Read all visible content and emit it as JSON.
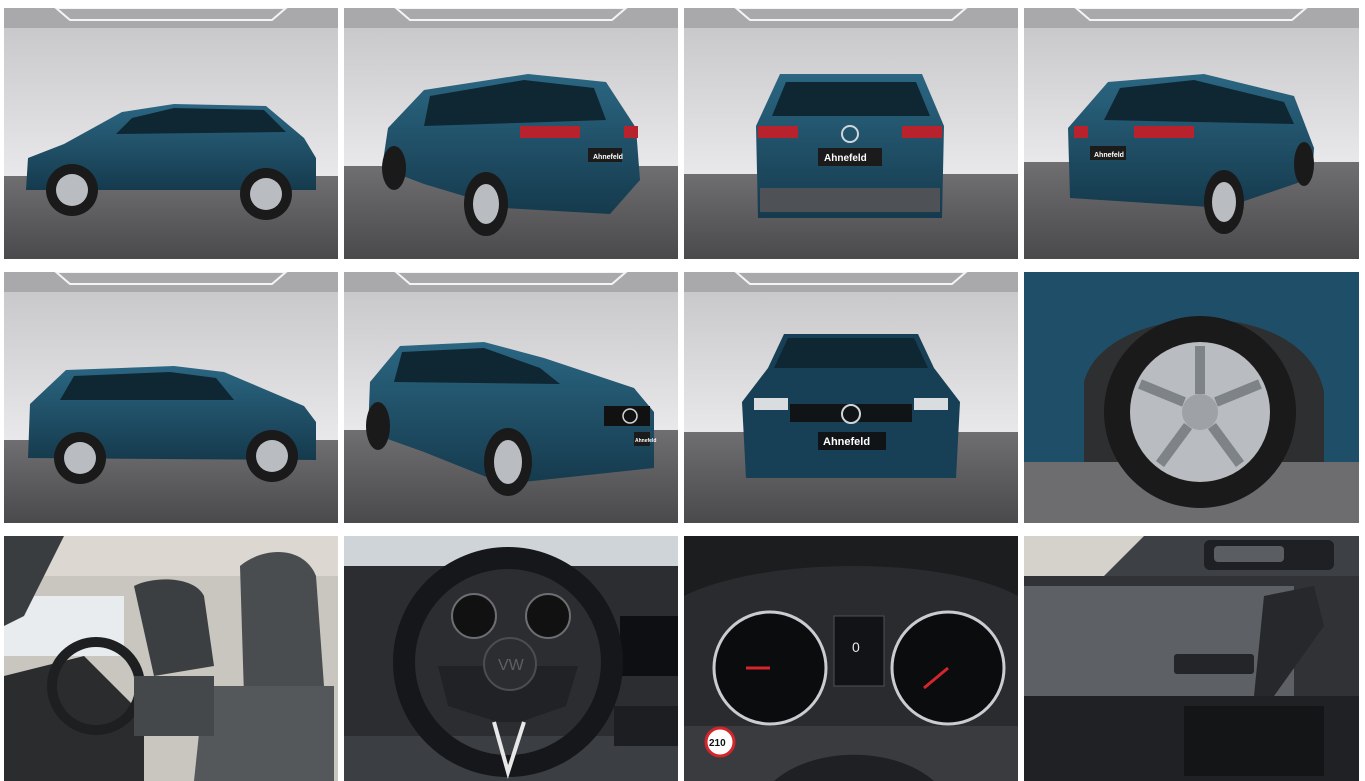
{
  "gallery": {
    "columns": 4,
    "rows": 3,
    "dealer_plate": "Ahnefeld",
    "speed_limit_sign": "210",
    "cluster_speed": "0",
    "car_color": "#1f4f68",
    "photos": [
      {
        "view": "side-left"
      },
      {
        "view": "rear-three-quarter-left"
      },
      {
        "view": "rear"
      },
      {
        "view": "rear-three-quarter-right"
      },
      {
        "view": "side-left-lower"
      },
      {
        "view": "front-three-quarter-left"
      },
      {
        "view": "front"
      },
      {
        "view": "wheel-closeup"
      },
      {
        "view": "interior-front-seats"
      },
      {
        "view": "steering-wheel"
      },
      {
        "view": "instrument-cluster"
      },
      {
        "view": "door-panel"
      }
    ]
  }
}
